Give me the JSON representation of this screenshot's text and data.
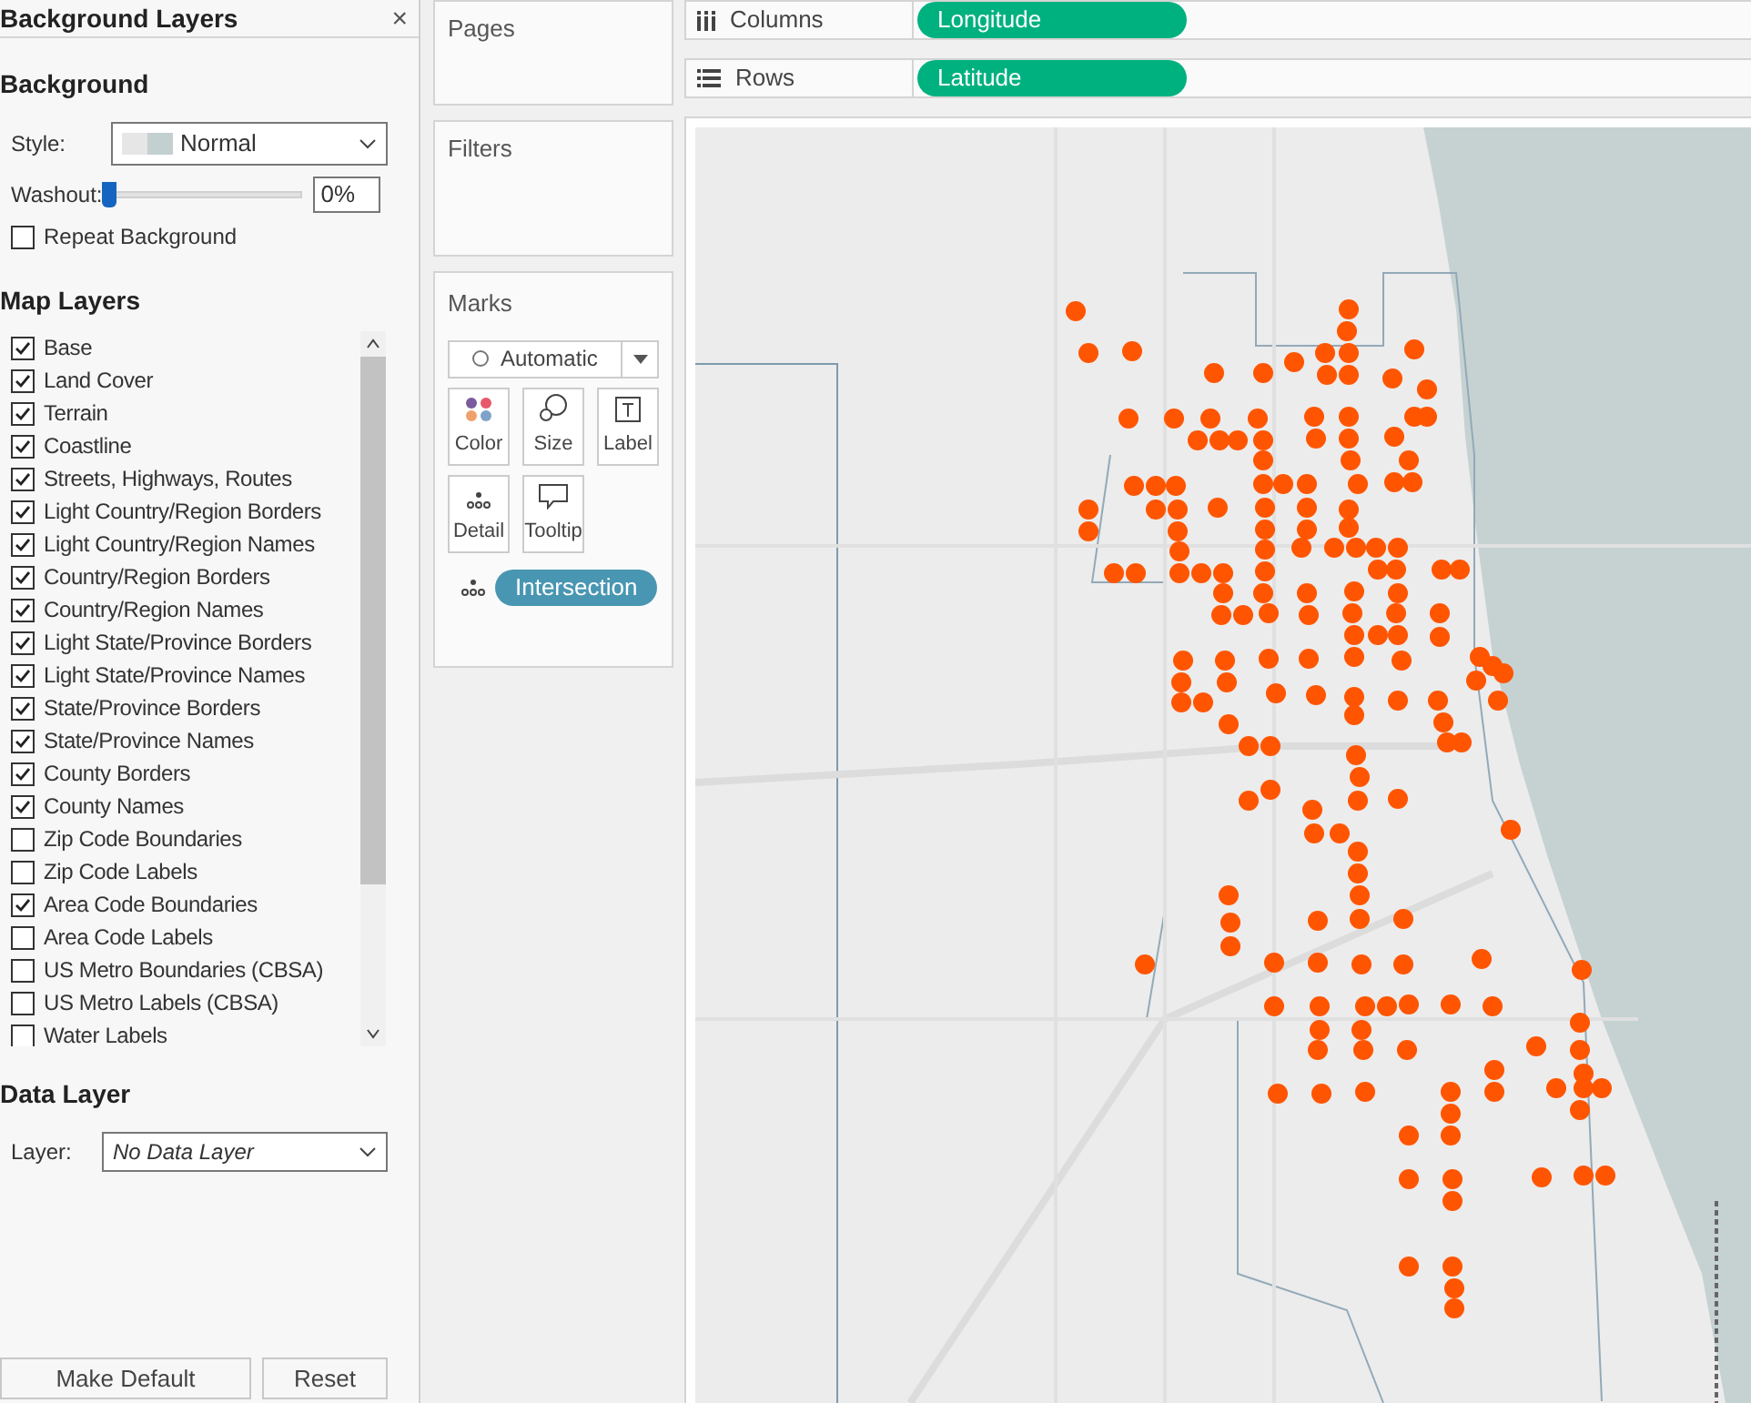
{
  "panel": {
    "title": "Background Layers",
    "close": "×",
    "background": {
      "heading": "Background",
      "style_label": "Style:",
      "style_value": "Normal",
      "washout_label": "Washout:",
      "washout": {
        "level": 0
      },
      "washout_value": "0%",
      "repeat": {
        "label": "Repeat Background",
        "checked": false
      }
    },
    "map_layers": {
      "heading": "Map Layers",
      "items": [
        {
          "label": "Base",
          "checked": true
        },
        {
          "label": "Land Cover",
          "checked": true
        },
        {
          "label": "Terrain",
          "checked": true
        },
        {
          "label": "Coastline",
          "checked": true
        },
        {
          "label": "Streets, Highways, Routes",
          "checked": true
        },
        {
          "label": "Light Country/Region Borders",
          "checked": true
        },
        {
          "label": "Light Country/Region Names",
          "checked": true
        },
        {
          "label": "Country/Region Borders",
          "checked": true
        },
        {
          "label": "Country/Region Names",
          "checked": true
        },
        {
          "label": "Light State/Province Borders",
          "checked": true
        },
        {
          "label": "Light State/Province Names",
          "checked": true
        },
        {
          "label": "State/Province Borders",
          "checked": true
        },
        {
          "label": "State/Province Names",
          "checked": true
        },
        {
          "label": "County Borders",
          "checked": true
        },
        {
          "label": "County Names",
          "checked": true
        },
        {
          "label": "Zip Code Boundaries",
          "checked": false
        },
        {
          "label": "Zip Code Labels",
          "checked": false
        },
        {
          "label": "Area Code Boundaries",
          "checked": true
        },
        {
          "label": "Area Code Labels",
          "checked": false
        },
        {
          "label": "US Metro Boundaries (CBSA)",
          "checked": false
        },
        {
          "label": "US Metro Labels (CBSA)",
          "checked": false
        },
        {
          "label": "Water Labels",
          "checked": false
        }
      ]
    },
    "data_layer": {
      "heading": "Data Layer",
      "layer_label": "Layer:",
      "layer_value": "No Data Layer"
    },
    "buttons": [
      "Make Default",
      "Reset"
    ]
  },
  "cards": {
    "pages": "Pages",
    "filters": "Filters",
    "marks": {
      "title": "Marks",
      "type": "Automatic",
      "buttons": [
        {
          "kind": "color",
          "label": "Color"
        },
        {
          "kind": "size",
          "label": "Size"
        },
        {
          "kind": "label",
          "label": "Label"
        },
        {
          "kind": "detail",
          "label": "Detail"
        },
        {
          "kind": "tooltip",
          "label": "Tooltip"
        }
      ],
      "pill": "Intersection"
    }
  },
  "shelves": [
    {
      "kind": "columns",
      "label": "Columns",
      "pill": "Longitude"
    },
    {
      "kind": "rows",
      "label": "Rows",
      "pill": "Latitude"
    }
  ]
}
